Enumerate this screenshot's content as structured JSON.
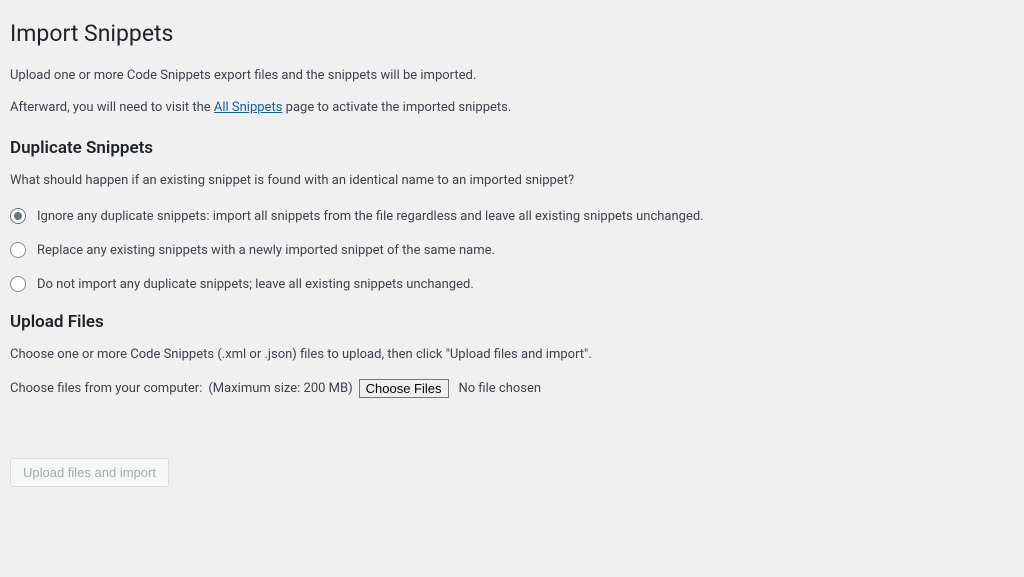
{
  "page": {
    "title": "Import Snippets",
    "intro1": "Upload one or more Code Snippets export files and the snippets will be imported.",
    "intro2_prefix": "Afterward, you will need to visit the ",
    "intro2_link": "All Snippets",
    "intro2_suffix": " page to activate the imported snippets."
  },
  "duplicate": {
    "heading": "Duplicate Snippets",
    "question": "What should happen if an existing snippet is found with an identical name to an imported snippet?",
    "options": {
      "ignore": "Ignore any duplicate snippets: import all snippets from the file regardless and leave all existing snippets unchanged.",
      "replace": "Replace any existing snippets with a newly imported snippet of the same name.",
      "skip": "Do not import any duplicate snippets; leave all existing snippets unchanged."
    }
  },
  "upload": {
    "heading": "Upload Files",
    "desc": "Choose one or more Code Snippets (.xml or .json) files to upload, then click \"Upload files and import\".",
    "chooseLabel": "Choose files from your computer:",
    "maxSize": "(Maximum size: 200 MB)",
    "buttonLabel": "Choose Files",
    "noFile": "No file chosen",
    "submitLabel": "Upload files and import"
  }
}
